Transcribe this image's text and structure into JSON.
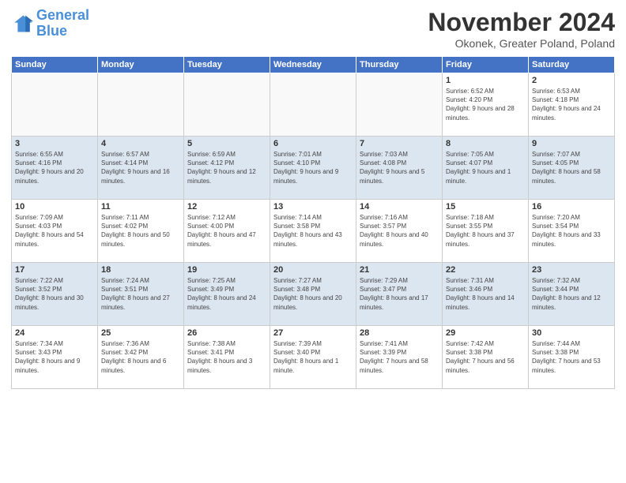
{
  "header": {
    "logo_line1": "General",
    "logo_line2": "Blue",
    "title": "November 2024",
    "subtitle": "Okonek, Greater Poland, Poland"
  },
  "days_of_week": [
    "Sunday",
    "Monday",
    "Tuesday",
    "Wednesday",
    "Thursday",
    "Friday",
    "Saturday"
  ],
  "weeks": [
    [
      {
        "day": "",
        "info": ""
      },
      {
        "day": "",
        "info": ""
      },
      {
        "day": "",
        "info": ""
      },
      {
        "day": "",
        "info": ""
      },
      {
        "day": "",
        "info": ""
      },
      {
        "day": "1",
        "info": "Sunrise: 6:52 AM\nSunset: 4:20 PM\nDaylight: 9 hours and 28 minutes."
      },
      {
        "day": "2",
        "info": "Sunrise: 6:53 AM\nSunset: 4:18 PM\nDaylight: 9 hours and 24 minutes."
      }
    ],
    [
      {
        "day": "3",
        "info": "Sunrise: 6:55 AM\nSunset: 4:16 PM\nDaylight: 9 hours and 20 minutes."
      },
      {
        "day": "4",
        "info": "Sunrise: 6:57 AM\nSunset: 4:14 PM\nDaylight: 9 hours and 16 minutes."
      },
      {
        "day": "5",
        "info": "Sunrise: 6:59 AM\nSunset: 4:12 PM\nDaylight: 9 hours and 12 minutes."
      },
      {
        "day": "6",
        "info": "Sunrise: 7:01 AM\nSunset: 4:10 PM\nDaylight: 9 hours and 9 minutes."
      },
      {
        "day": "7",
        "info": "Sunrise: 7:03 AM\nSunset: 4:08 PM\nDaylight: 9 hours and 5 minutes."
      },
      {
        "day": "8",
        "info": "Sunrise: 7:05 AM\nSunset: 4:07 PM\nDaylight: 9 hours and 1 minute."
      },
      {
        "day": "9",
        "info": "Sunrise: 7:07 AM\nSunset: 4:05 PM\nDaylight: 8 hours and 58 minutes."
      }
    ],
    [
      {
        "day": "10",
        "info": "Sunrise: 7:09 AM\nSunset: 4:03 PM\nDaylight: 8 hours and 54 minutes."
      },
      {
        "day": "11",
        "info": "Sunrise: 7:11 AM\nSunset: 4:02 PM\nDaylight: 8 hours and 50 minutes."
      },
      {
        "day": "12",
        "info": "Sunrise: 7:12 AM\nSunset: 4:00 PM\nDaylight: 8 hours and 47 minutes."
      },
      {
        "day": "13",
        "info": "Sunrise: 7:14 AM\nSunset: 3:58 PM\nDaylight: 8 hours and 43 minutes."
      },
      {
        "day": "14",
        "info": "Sunrise: 7:16 AM\nSunset: 3:57 PM\nDaylight: 8 hours and 40 minutes."
      },
      {
        "day": "15",
        "info": "Sunrise: 7:18 AM\nSunset: 3:55 PM\nDaylight: 8 hours and 37 minutes."
      },
      {
        "day": "16",
        "info": "Sunrise: 7:20 AM\nSunset: 3:54 PM\nDaylight: 8 hours and 33 minutes."
      }
    ],
    [
      {
        "day": "17",
        "info": "Sunrise: 7:22 AM\nSunset: 3:52 PM\nDaylight: 8 hours and 30 minutes."
      },
      {
        "day": "18",
        "info": "Sunrise: 7:24 AM\nSunset: 3:51 PM\nDaylight: 8 hours and 27 minutes."
      },
      {
        "day": "19",
        "info": "Sunrise: 7:25 AM\nSunset: 3:49 PM\nDaylight: 8 hours and 24 minutes."
      },
      {
        "day": "20",
        "info": "Sunrise: 7:27 AM\nSunset: 3:48 PM\nDaylight: 8 hours and 20 minutes."
      },
      {
        "day": "21",
        "info": "Sunrise: 7:29 AM\nSunset: 3:47 PM\nDaylight: 8 hours and 17 minutes."
      },
      {
        "day": "22",
        "info": "Sunrise: 7:31 AM\nSunset: 3:46 PM\nDaylight: 8 hours and 14 minutes."
      },
      {
        "day": "23",
        "info": "Sunrise: 7:32 AM\nSunset: 3:44 PM\nDaylight: 8 hours and 12 minutes."
      }
    ],
    [
      {
        "day": "24",
        "info": "Sunrise: 7:34 AM\nSunset: 3:43 PM\nDaylight: 8 hours and 9 minutes."
      },
      {
        "day": "25",
        "info": "Sunrise: 7:36 AM\nSunset: 3:42 PM\nDaylight: 8 hours and 6 minutes."
      },
      {
        "day": "26",
        "info": "Sunrise: 7:38 AM\nSunset: 3:41 PM\nDaylight: 8 hours and 3 minutes."
      },
      {
        "day": "27",
        "info": "Sunrise: 7:39 AM\nSunset: 3:40 PM\nDaylight: 8 hours and 1 minute."
      },
      {
        "day": "28",
        "info": "Sunrise: 7:41 AM\nSunset: 3:39 PM\nDaylight: 7 hours and 58 minutes."
      },
      {
        "day": "29",
        "info": "Sunrise: 7:42 AM\nSunset: 3:38 PM\nDaylight: 7 hours and 56 minutes."
      },
      {
        "day": "30",
        "info": "Sunrise: 7:44 AM\nSunset: 3:38 PM\nDaylight: 7 hours and 53 minutes."
      }
    ]
  ]
}
